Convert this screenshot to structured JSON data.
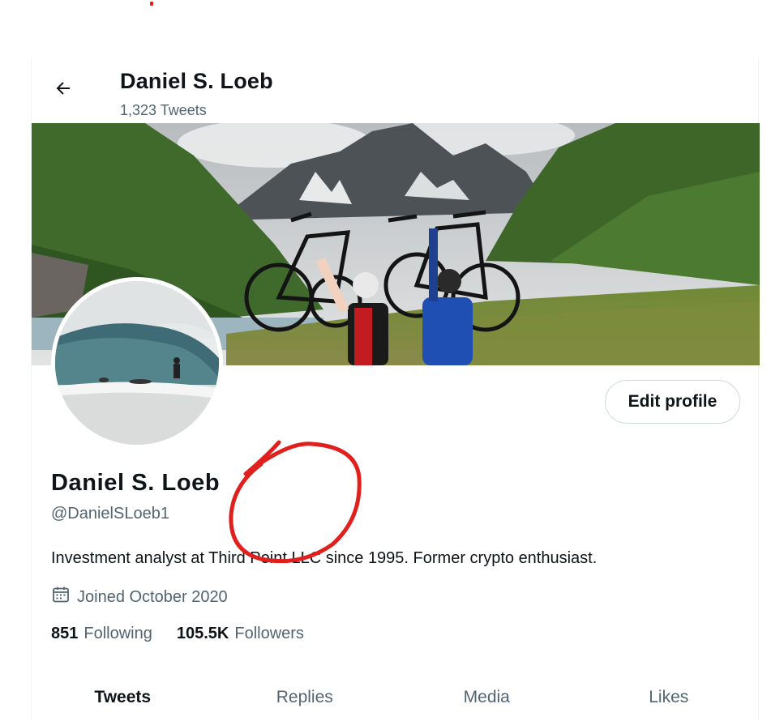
{
  "header": {
    "title": "Daniel S. Loeb",
    "tweet_count": "1,323 Tweets"
  },
  "profile": {
    "name": "Daniel S. Loeb",
    "handle": "@DanielSLoeb1",
    "bio": "Investment analyst at Third Point LLC since 1995. Former crypto enthusiast.",
    "joined": "Joined October 2020",
    "edit_label": "Edit profile"
  },
  "stats": {
    "following_count": "851",
    "following_label": "Following",
    "followers_count": "105.5K",
    "followers_label": "Followers"
  },
  "tabs": [
    {
      "label": "Tweets",
      "active": true
    },
    {
      "label": "Replies",
      "active": false
    },
    {
      "label": "Media",
      "active": false
    },
    {
      "label": "Likes",
      "active": false
    }
  ],
  "icons": {
    "back": "arrow-left-icon",
    "calendar": "calendar-icon"
  },
  "colors": {
    "text": "#0f1419",
    "secondary": "#536471",
    "border": "#cfd9de",
    "annotation": "#e0201c"
  }
}
